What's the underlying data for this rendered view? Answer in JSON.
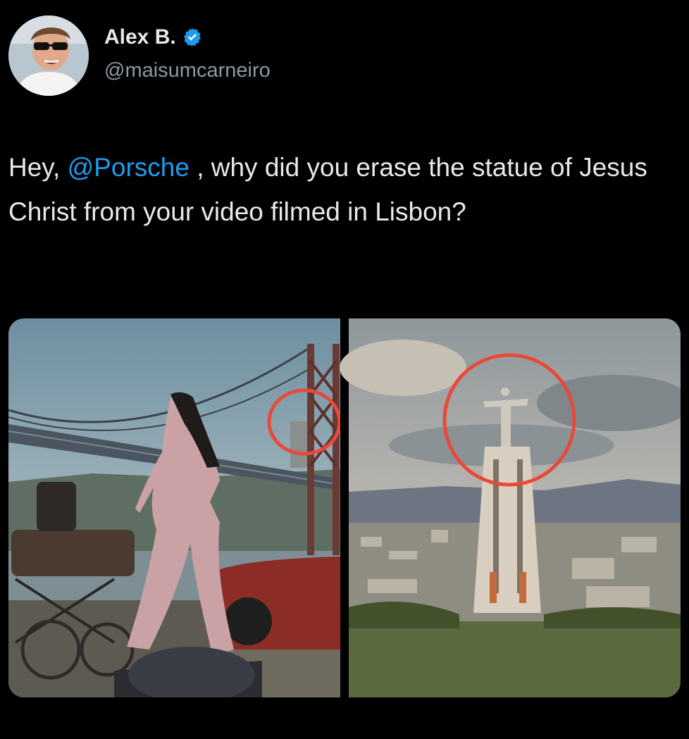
{
  "author": {
    "name": "Alex B.",
    "handle": "@maisumcarneiro",
    "verified": true
  },
  "tweet": {
    "text_before": "Hey, ",
    "mention": "@Porsche",
    "text_after": " , why did you erase the statue of Jesus Christ from your video filmed in Lisbon?"
  },
  "media": {
    "left_image": "porsche-video-still-bridge-without-statue",
    "right_image": "cristo-rei-statue-lisbon",
    "highlight_color": "#e8493a"
  },
  "colors": {
    "background": "#000000",
    "text": "#e7e9ea",
    "secondary": "#8b98a5",
    "link": "#1d9bf0"
  }
}
